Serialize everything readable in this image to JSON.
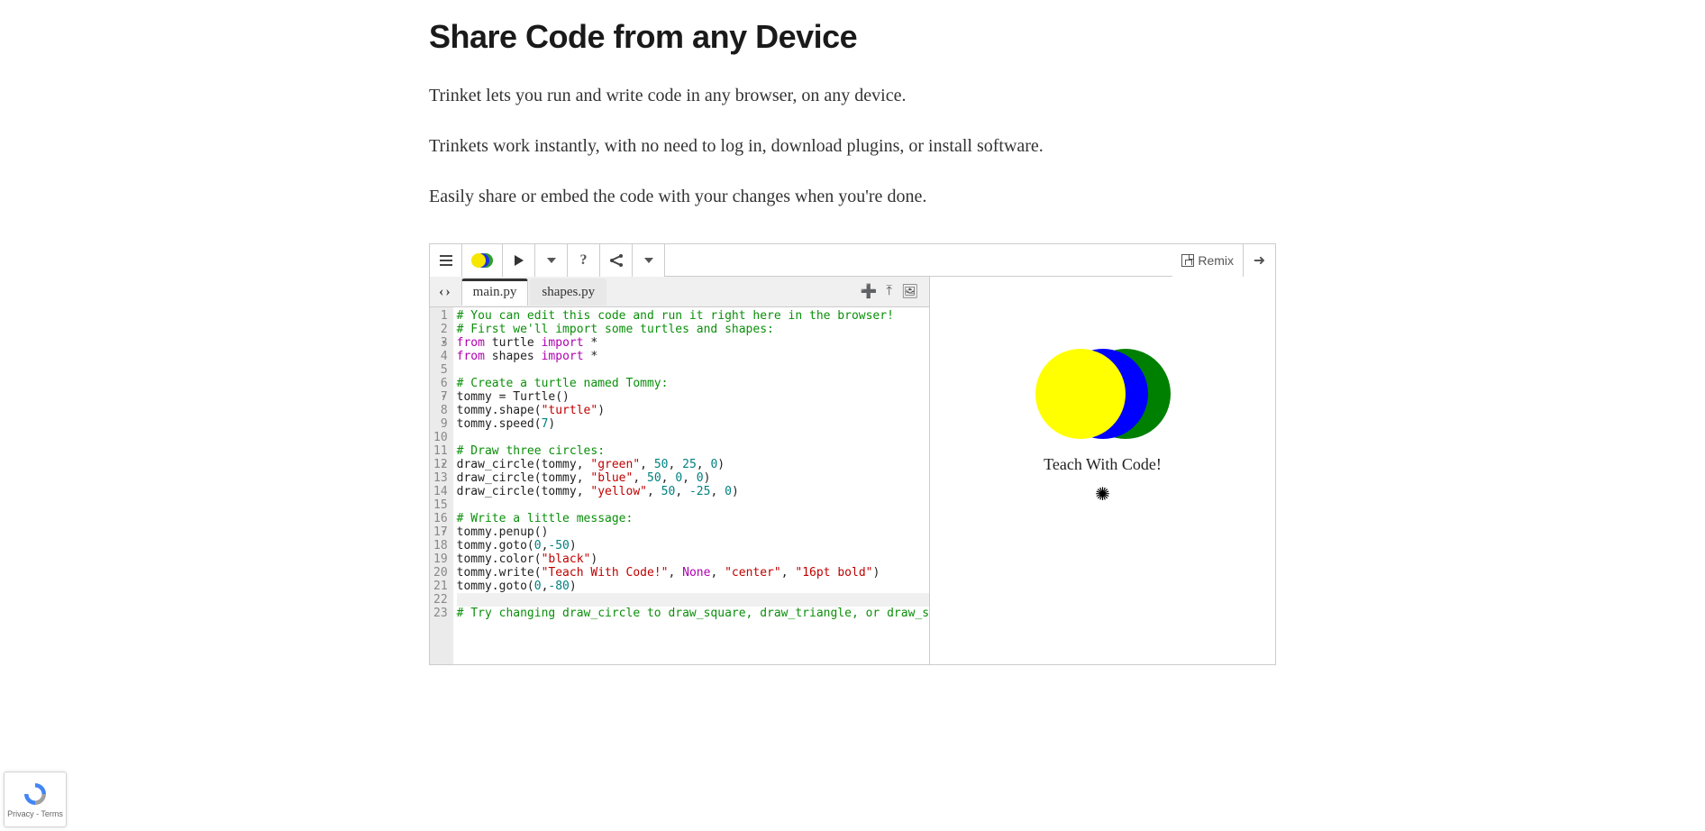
{
  "heading": "Share Code from any Device",
  "intro": [
    "Trinket lets you run and write code in any browser, on any device.",
    "Trinkets work instantly, with no need to log in, download plugins, or install software.",
    "Easily share or embed the code with your changes when you're done."
  ],
  "toolbar": {
    "remix_label": "Remix"
  },
  "tabs": [
    "main.py",
    "shapes.py"
  ],
  "active_tab": 0,
  "code_lines": [
    {
      "n": 1,
      "fold": false,
      "tokens": [
        {
          "cls": "c-comment",
          "t": "# You can edit this code and run it right here in the browser!"
        }
      ]
    },
    {
      "n": 2,
      "fold": true,
      "tokens": [
        {
          "cls": "c-comment",
          "t": "# First we'll import some turtles and shapes:"
        }
      ]
    },
    {
      "n": 3,
      "fold": false,
      "tokens": [
        {
          "cls": "c-kw",
          "t": "from"
        },
        {
          "cls": "c-id",
          "t": " turtle "
        },
        {
          "cls": "c-kw",
          "t": "import"
        },
        {
          "cls": "c-id",
          "t": " *"
        }
      ]
    },
    {
      "n": 4,
      "fold": false,
      "tokens": [
        {
          "cls": "c-kw",
          "t": "from"
        },
        {
          "cls": "c-id",
          "t": " shapes "
        },
        {
          "cls": "c-kw",
          "t": "import"
        },
        {
          "cls": "c-id",
          "t": " *"
        }
      ]
    },
    {
      "n": 5,
      "fold": false,
      "tokens": []
    },
    {
      "n": 6,
      "fold": true,
      "tokens": [
        {
          "cls": "c-comment",
          "t": "# Create a turtle named Tommy:"
        }
      ]
    },
    {
      "n": 7,
      "fold": false,
      "tokens": [
        {
          "cls": "c-id",
          "t": "tommy = Turtle()"
        }
      ]
    },
    {
      "n": 8,
      "fold": false,
      "tokens": [
        {
          "cls": "c-id",
          "t": "tommy.shape("
        },
        {
          "cls": "c-str",
          "t": "\"turtle\""
        },
        {
          "cls": "c-id",
          "t": ")"
        }
      ]
    },
    {
      "n": 9,
      "fold": false,
      "tokens": [
        {
          "cls": "c-id",
          "t": "tommy.speed("
        },
        {
          "cls": "c-num",
          "t": "7"
        },
        {
          "cls": "c-id",
          "t": ")"
        }
      ]
    },
    {
      "n": 10,
      "fold": false,
      "tokens": []
    },
    {
      "n": 11,
      "fold": true,
      "tokens": [
        {
          "cls": "c-comment",
          "t": "# Draw three circles:"
        }
      ]
    },
    {
      "n": 12,
      "fold": false,
      "tokens": [
        {
          "cls": "c-id",
          "t": "draw_circle(tommy, "
        },
        {
          "cls": "c-str",
          "t": "\"green\""
        },
        {
          "cls": "c-id",
          "t": ", "
        },
        {
          "cls": "c-num",
          "t": "50"
        },
        {
          "cls": "c-id",
          "t": ", "
        },
        {
          "cls": "c-num",
          "t": "25"
        },
        {
          "cls": "c-id",
          "t": ", "
        },
        {
          "cls": "c-num",
          "t": "0"
        },
        {
          "cls": "c-id",
          "t": ")"
        }
      ]
    },
    {
      "n": 13,
      "fold": false,
      "tokens": [
        {
          "cls": "c-id",
          "t": "draw_circle(tommy, "
        },
        {
          "cls": "c-str",
          "t": "\"blue\""
        },
        {
          "cls": "c-id",
          "t": ", "
        },
        {
          "cls": "c-num",
          "t": "50"
        },
        {
          "cls": "c-id",
          "t": ", "
        },
        {
          "cls": "c-num",
          "t": "0"
        },
        {
          "cls": "c-id",
          "t": ", "
        },
        {
          "cls": "c-num",
          "t": "0"
        },
        {
          "cls": "c-id",
          "t": ")"
        }
      ]
    },
    {
      "n": 14,
      "fold": false,
      "tokens": [
        {
          "cls": "c-id",
          "t": "draw_circle(tommy, "
        },
        {
          "cls": "c-str",
          "t": "\"yellow\""
        },
        {
          "cls": "c-id",
          "t": ", "
        },
        {
          "cls": "c-num",
          "t": "50"
        },
        {
          "cls": "c-id",
          "t": ", "
        },
        {
          "cls": "c-num",
          "t": "-25"
        },
        {
          "cls": "c-id",
          "t": ", "
        },
        {
          "cls": "c-num",
          "t": "0"
        },
        {
          "cls": "c-id",
          "t": ")"
        }
      ]
    },
    {
      "n": 15,
      "fold": false,
      "tokens": []
    },
    {
      "n": 16,
      "fold": true,
      "tokens": [
        {
          "cls": "c-comment",
          "t": "# Write a little message:"
        }
      ]
    },
    {
      "n": 17,
      "fold": false,
      "tokens": [
        {
          "cls": "c-id",
          "t": "tommy.penup()"
        }
      ]
    },
    {
      "n": 18,
      "fold": false,
      "tokens": [
        {
          "cls": "c-id",
          "t": "tommy.goto("
        },
        {
          "cls": "c-num",
          "t": "0"
        },
        {
          "cls": "c-id",
          "t": ","
        },
        {
          "cls": "c-num",
          "t": "-50"
        },
        {
          "cls": "c-id",
          "t": ")"
        }
      ]
    },
    {
      "n": 19,
      "fold": false,
      "tokens": [
        {
          "cls": "c-id",
          "t": "tommy.color("
        },
        {
          "cls": "c-str",
          "t": "\"black\""
        },
        {
          "cls": "c-id",
          "t": ")"
        }
      ]
    },
    {
      "n": 20,
      "fold": false,
      "tokens": [
        {
          "cls": "c-id",
          "t": "tommy.write("
        },
        {
          "cls": "c-str",
          "t": "\"Teach With Code!\""
        },
        {
          "cls": "c-id",
          "t": ", "
        },
        {
          "cls": "c-kw",
          "t": "None"
        },
        {
          "cls": "c-id",
          "t": ", "
        },
        {
          "cls": "c-str",
          "t": "\"center\""
        },
        {
          "cls": "c-id",
          "t": ", "
        },
        {
          "cls": "c-str",
          "t": "\"16pt bold\""
        },
        {
          "cls": "c-id",
          "t": ")"
        }
      ]
    },
    {
      "n": 21,
      "fold": false,
      "tokens": [
        {
          "cls": "c-id",
          "t": "tommy.goto("
        },
        {
          "cls": "c-num",
          "t": "0"
        },
        {
          "cls": "c-id",
          "t": ","
        },
        {
          "cls": "c-num",
          "t": "-80"
        },
        {
          "cls": "c-id",
          "t": ")"
        }
      ]
    },
    {
      "n": 22,
      "fold": false,
      "hl": true,
      "tokens": []
    },
    {
      "n": 23,
      "fold": false,
      "tokens": [
        {
          "cls": "c-comment",
          "t": "# Try changing draw_circle to draw_square, draw_triangle, or draw_star"
        }
      ]
    }
  ],
  "output": {
    "message": "Teach With Code!"
  },
  "recaptcha": {
    "footer": "Privacy - Terms"
  }
}
